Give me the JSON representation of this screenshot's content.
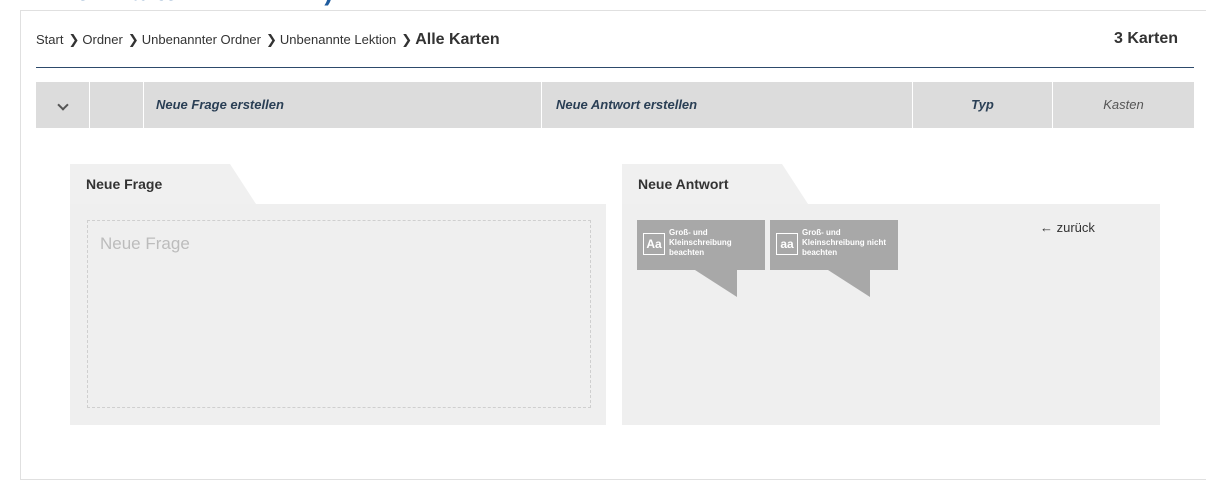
{
  "breadcrumb": {
    "items": [
      "Start",
      "Ordner",
      "Unbenannter Ordner",
      "Unbenannte Lektion"
    ],
    "current": "Alle Karten",
    "separator": "❯"
  },
  "card_count": "3 Karten",
  "table_header": {
    "question": "Neue Frage erstellen",
    "answer": "Neue Antwort erstellen",
    "type": "Typ",
    "box": "Kasten"
  },
  "question_panel": {
    "tab_label": "Neue Frage",
    "placeholder": "Neue Frage"
  },
  "answer_panel": {
    "tab_label": "Neue Antwort",
    "case_sensitive": {
      "glyph": "Aa",
      "label": "Groß- und Kleinschreibung beachten"
    },
    "case_insensitive": {
      "glyph": "aa",
      "label": "Groß- und Kleinschreibung nicht beachten"
    },
    "back_icon": "←",
    "back_label": "zurück"
  },
  "colors": {
    "header_bg": "#dcdcdc",
    "panel_bg": "#efefef",
    "accent_line": "#2d4a6b",
    "button_gray": "#a8a8a8"
  }
}
